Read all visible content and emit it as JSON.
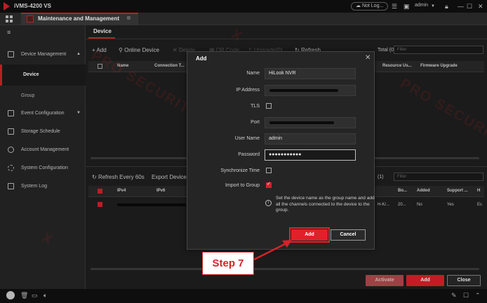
{
  "window": {
    "app_title": "iVMS-4200 VS",
    "account_status": "Not Log...",
    "user": "admin"
  },
  "tab": {
    "label": "Maintenance and Management"
  },
  "sidebar": {
    "items": [
      {
        "label": "Device Management",
        "arrow": "▲"
      },
      {
        "label": "Device"
      },
      {
        "label": "Group"
      },
      {
        "label": "Event Configuration",
        "arrow": "▼"
      },
      {
        "label": "Storage Schedule"
      },
      {
        "label": "Account Management"
      },
      {
        "label": "System Configuration"
      },
      {
        "label": "System Log"
      }
    ]
  },
  "main": {
    "page_tab": "Device",
    "toolbar": {
      "add": "+ Add",
      "online_device": "Online Device",
      "delete": "Delete",
      "qr_code": "QR Code",
      "upgrade": "Upgrade(0)",
      "refresh": "Refresh"
    },
    "total": "Total (0)",
    "filter_placeholder": "Filter",
    "device_table": {
      "columns": [
        "Name",
        "Connection T...",
        "Resource Us...",
        "Firmware Upgrade"
      ]
    },
    "online": {
      "refresh": "Refresh Every 60s",
      "export": "Export Device",
      "total": "(1)",
      "filter_placeholder": "Filter",
      "columns": [
        "IPv4",
        "IPv6",
        "Bo...",
        "Added",
        "Support ...",
        "H"
      ],
      "row": {
        "bo": "20...",
        "added": "No",
        "support": "Yes",
        "h": "Ec",
        "model": "H-K/..."
      }
    },
    "buttons": {
      "activate": "Activate",
      "add": "Add",
      "close": "Close"
    }
  },
  "modal": {
    "title": "Add",
    "fields": {
      "name_label": "Name",
      "name_value": "HiLook NVR",
      "ip_label": "IP Address",
      "tls_label": "TLS",
      "port_label": "Port",
      "username_label": "User Name",
      "username_value": "admin",
      "password_label": "Password",
      "password_value": "●●●●●●●●●●●",
      "sync_label": "Synchronize Time",
      "import_label": "Import to Group"
    },
    "hint": "Set the device name as the group name and add all the channels connected to the device to the group.",
    "add_button": "Add",
    "cancel_button": "Cancel"
  },
  "annotation": {
    "step_text": "Step 7"
  },
  "watermark": {
    "text": "PRO SECURITY"
  },
  "colors": {
    "accent": "#d4232b",
    "background": "#1f1f1f"
  }
}
